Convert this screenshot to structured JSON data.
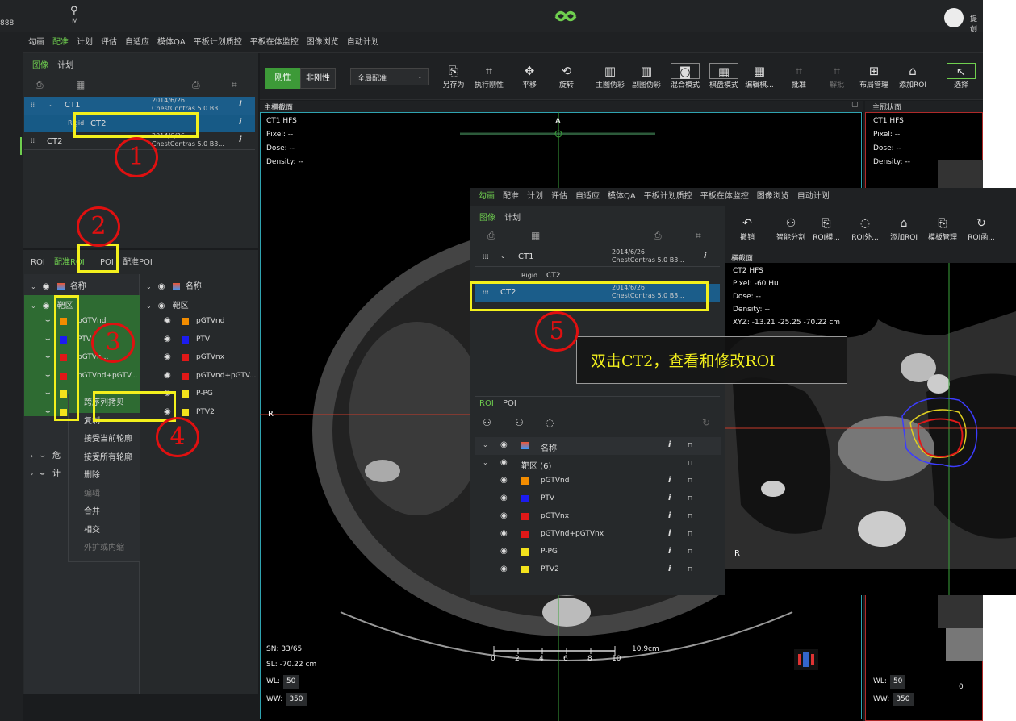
{
  "titlebar": {
    "left_number": "888",
    "search_letter": "M",
    "user_label": "提创"
  },
  "menu": {
    "items": [
      "勾画",
      "配准",
      "计划",
      "评估",
      "自适应",
      "模体QA",
      "平板计划质控",
      "平板在体监控",
      "图像浏览",
      "自动计划"
    ],
    "active_index": 1
  },
  "left_panel": {
    "tabs": [
      "图像",
      "计划"
    ],
    "series": [
      {
        "name": "CT1",
        "date": "2014/6/26",
        "desc": "ChestContras 5.0 B3..."
      },
      {
        "reg_type": "Rigid",
        "name": "CT2"
      },
      {
        "name": "CT2",
        "date": "2014/6/26",
        "desc": "ChestContras 5.0 B3..."
      }
    ],
    "roi_tabs": [
      "ROI",
      "配准ROI",
      "POI",
      "配准POI"
    ],
    "header_name": "名称",
    "group_label": "靶区",
    "roi_list": [
      {
        "name": "pGTVnd",
        "color": "#f28c00"
      },
      {
        "name": "PTV",
        "color": "#1c1cf0"
      },
      {
        "name": "pGTVnx",
        "color": "#e01818"
      },
      {
        "name": "pGTVnd+pGTV...",
        "color": "#e01818"
      },
      {
        "name": "P-PG",
        "color": "#f3e21c"
      },
      {
        "name": "PTV2",
        "color": "#f3e21c"
      }
    ],
    "left_list_names": [
      "pGTVnd",
      "PTV",
      "pGTVn...",
      "pGTVnd+pGTV..."
    ],
    "collapsed_rows": [
      "危",
      "计"
    ]
  },
  "context_menu": {
    "items": [
      "跨序列拷贝",
      "复制",
      "接受当前轮廓",
      "接受所有轮廓",
      "删除",
      "编辑",
      "合并",
      "相交",
      "外扩或内缩"
    ],
    "disabled": [
      5,
      8
    ]
  },
  "toolbar": {
    "rigid_btn": "刚性",
    "nonrigid_btn": "非刚性",
    "reg_select": "全局配准",
    "buttons": [
      {
        "label": "另存为",
        "icon": "save-as-icon",
        "glyph": "⎘"
      },
      {
        "label": "执行刚性",
        "icon": "execute-rigid-icon",
        "glyph": "⌗"
      },
      {
        "label": "平移",
        "icon": "pan-icon",
        "glyph": "✥"
      },
      {
        "label": "旋转",
        "icon": "rotate-icon",
        "glyph": "⟲"
      },
      {
        "label": "主图伪彩",
        "icon": "primary-pseudo-color-icon",
        "glyph": "▥"
      },
      {
        "label": "副图伪彩",
        "icon": "secondary-pseudo-color-icon",
        "glyph": "▥"
      },
      {
        "label": "混合模式",
        "icon": "blend-mode-icon",
        "glyph": "◙"
      },
      {
        "label": "棋盘模式",
        "icon": "checkerboard-icon",
        "glyph": "▦"
      },
      {
        "label": "编辑棋...",
        "icon": "edit-checkerboard-icon",
        "glyph": "▦"
      },
      {
        "label": "批准",
        "icon": "approve-icon",
        "glyph": "⌗"
      },
      {
        "label": "解批",
        "icon": "unapprove-icon",
        "glyph": "⌗"
      },
      {
        "label": "布局管理",
        "icon": "layout-icon",
        "glyph": "⊞"
      },
      {
        "label": "添加ROI",
        "icon": "add-roi-icon",
        "glyph": "⌂"
      },
      {
        "label": "选择",
        "icon": "select-icon",
        "glyph": "↖"
      }
    ]
  },
  "main_view": {
    "title": "主横截面",
    "series": "CT1 HFS",
    "pixel": "Pixel: --",
    "dose": "Dose: --",
    "density": "Density: --",
    "orient_top": "A",
    "orient_left": "R",
    "sn": "SN: 33/65",
    "sl": "SL: -70.22 cm",
    "wl_label": "WL:",
    "wl_value": "50",
    "ww_label": "WW:",
    "ww_value": "350",
    "scale_label": "10.9cm",
    "scale_ticks": [
      "0",
      "2",
      "4",
      "6",
      "8",
      "10"
    ]
  },
  "right_view": {
    "title": "主冠状面",
    "series": "CT1 HFS",
    "pixel": "Pixel: --",
    "dose": "Dose: --",
    "density": "Density: --",
    "wl_label": "WL:",
    "wl_value": "50",
    "ww_label": "WW:",
    "ww_value": "350",
    "tick0": "0"
  },
  "overlay": {
    "menu_items": [
      "勾画",
      "配准",
      "计划",
      "评估",
      "自适应",
      "模体QA",
      "平板计划质控",
      "平板在体监控",
      "图像浏览",
      "自动计划"
    ],
    "tabs": [
      "图像",
      "计划"
    ],
    "tools": [
      {
        "label": "撤销",
        "icon": "undo-icon",
        "glyph": "↶"
      },
      {
        "label": "智能分割",
        "icon": "smart-segment-icon",
        "glyph": "⚇"
      },
      {
        "label": "ROI模...",
        "icon": "roi-template-icon",
        "glyph": "⎘"
      },
      {
        "label": "ROI外...",
        "icon": "roi-expand-icon",
        "glyph": "◌"
      },
      {
        "label": "添加ROI",
        "icon": "add-roi-icon",
        "glyph": "⌂"
      },
      {
        "label": "模板管理",
        "icon": "template-manage-icon",
        "glyph": "⎘"
      },
      {
        "label": "ROI函...",
        "icon": "roi-function-icon",
        "glyph": "↻"
      }
    ],
    "series": [
      {
        "name": "CT1",
        "date": "2014/6/26",
        "desc": "ChestContras 5.0 B3..."
      },
      {
        "reg_type": "Rigid",
        "name": "CT2"
      },
      {
        "name": "CT2",
        "date": "2014/6/26",
        "desc": "ChestContras 5.0 B3..."
      }
    ],
    "roi_tabs": [
      "ROI",
      "POI"
    ],
    "header_name": "名称",
    "group_label": "靶区 (6)",
    "roi_list": [
      {
        "name": "pGTVnd",
        "color": "#f28c00"
      },
      {
        "name": "PTV",
        "color": "#1c1cf0"
      },
      {
        "name": "pGTVnx",
        "color": "#e01818"
      },
      {
        "name": "pGTVnd+pGTVnx",
        "color": "#e01818"
      },
      {
        "name": "P-PG",
        "color": "#f3e21c"
      },
      {
        "name": "PTV2",
        "color": "#f3e21c"
      }
    ],
    "view": {
      "title": "横截面",
      "series": "CT2 HFS",
      "pixel": "Pixel: -60 Hu",
      "dose": "Dose: --",
      "density": "Density: --",
      "xyz": "XYZ: -13.21 -25.25 -70.22 cm",
      "orient_left": "R"
    }
  },
  "annotations": {
    "n1": "1",
    "n2": "2",
    "n3": "3",
    "n4": "4",
    "n5": "5",
    "callout": "双击CT2，查看和修改ROI"
  },
  "colors": {
    "accent": "#6fcf4f",
    "highlight": "#1b5d8a",
    "annotation_yellow": "#f3f01d",
    "annotation_red": "#e01010"
  }
}
